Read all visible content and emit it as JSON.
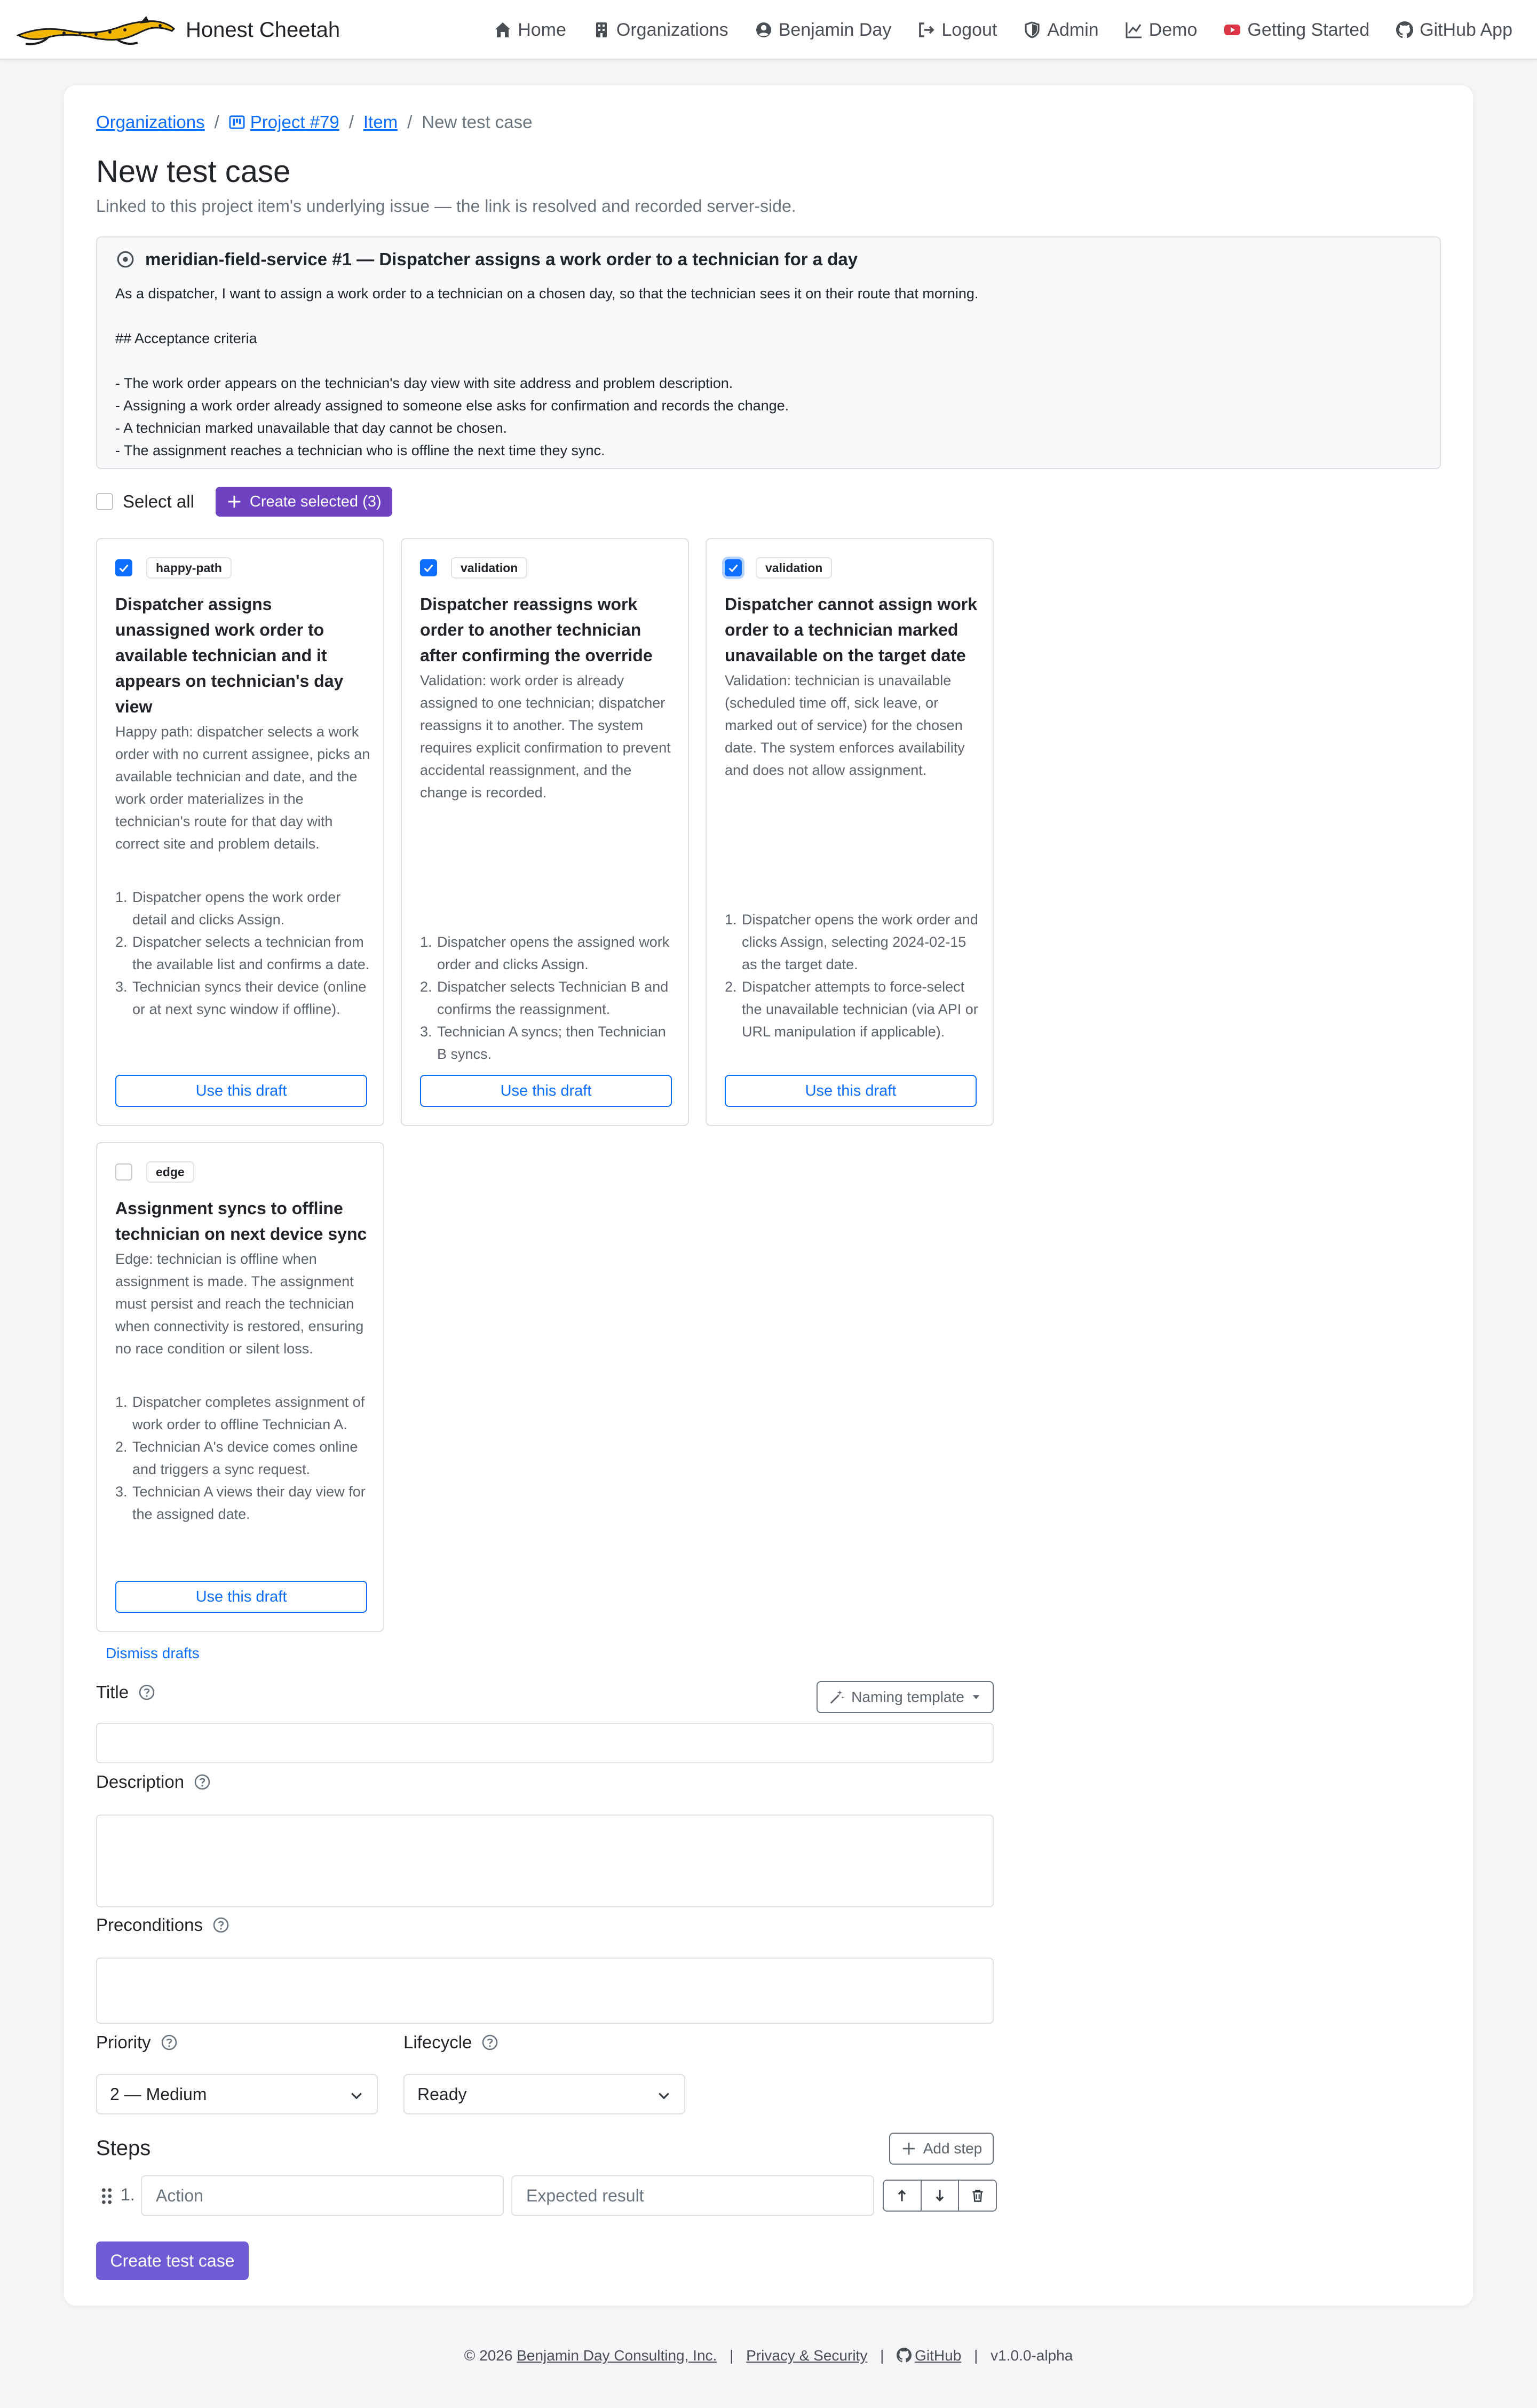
{
  "nav": {
    "brand": "Honest Cheetah",
    "links": [
      {
        "label": "Home",
        "icon": "house-icon"
      },
      {
        "label": "Organizations",
        "icon": "building-icon"
      },
      {
        "label": "Benjamin Day",
        "icon": "person-circle-icon"
      },
      {
        "label": "Logout",
        "icon": "logout-icon"
      },
      {
        "label": "Admin",
        "icon": "shield-icon"
      },
      {
        "label": "Demo",
        "icon": "graph-icon"
      },
      {
        "label": "Getting Started",
        "icon": "youtube-icon"
      },
      {
        "label": "GitHub App",
        "icon": "github-icon"
      }
    ]
  },
  "breadcrumb": {
    "organizations": "Organizations",
    "project": "Project #79",
    "item": "Item",
    "current": "New test case"
  },
  "page": {
    "title": "New test case",
    "subtitle": "Linked to this project item's underlying issue — the link is resolved and recorded server-side."
  },
  "issue": {
    "title": "meridian-field-service #1 — Dispatcher assigns a work order to a technician for a day",
    "body": "As a dispatcher, I want to assign a work order to a technician on a chosen day, so that the technician sees it on their route that morning.\n\n## Acceptance criteria\n\n- The work order appears on the technician's day view with site address and problem description.\n- Assigning a work order already assigned to someone else asks for confirmation and records the change.\n- A technician marked unavailable that day cannot be chosen.\n- The assignment reaches a technician who is offline the next time they sync."
  },
  "selection": {
    "select_all": "Select all",
    "create_selected": "Create selected (3)"
  },
  "drafts": [
    {
      "tag": "happy-path",
      "checked": true,
      "title": "Dispatcher assigns unassigned work order to available technician and it appears on technician's day view",
      "description": "Happy path: dispatcher selects a work order with no current assignee, picks an available technician and date, and the work order materializes in the technician's route for that day with correct site and problem details.",
      "steps": [
        "Dispatcher opens the work order detail and clicks Assign.",
        "Dispatcher selects a technician from the available list and confirms a date.",
        "Technician syncs their device (online or at next sync window if offline)."
      ],
      "button": "Use this draft"
    },
    {
      "tag": "validation",
      "checked": true,
      "title": "Dispatcher reassigns work order to another technician after confirming the override",
      "description": "Validation: work order is already assigned to one technician; dispatcher reassigns it to another. The system requires explicit confirmation to prevent accidental reassignment, and the change is recorded.",
      "steps": [
        "Dispatcher opens the assigned work order and clicks Assign.",
        "Dispatcher selects Technician B and confirms the reassignment.",
        "Technician A syncs; then Technician B syncs."
      ],
      "button": "Use this draft"
    },
    {
      "tag": "validation",
      "checked": true,
      "title": "Dispatcher cannot assign work order to a technician marked unavailable on the target date",
      "description": "Validation: technician is unavailable (scheduled time off, sick leave, or marked out of service) for the chosen date. The system enforces availability and does not allow assignment.",
      "steps": [
        "Dispatcher opens the work order and clicks Assign, selecting 2024-02-15 as the target date.",
        "Dispatcher attempts to force-select the unavailable technician (via API or URL manipulation if applicable)."
      ],
      "button": "Use this draft"
    },
    {
      "tag": "edge",
      "checked": false,
      "title": "Assignment syncs to offline technician on next device sync",
      "description": "Edge: technician is offline when assignment is made. The assignment must persist and reach the technician when connectivity is restored, ensuring no race condition or silent loss.",
      "steps": [
        "Dispatcher completes assignment of work order to offline Technician A.",
        "Technician A's device comes online and triggers a sync request.",
        "Technician A views their day view for the assigned date."
      ],
      "button": "Use this draft"
    }
  ],
  "dismiss_drafts": "Dismiss drafts",
  "form": {
    "title_label": "Title",
    "title_value": "",
    "naming_template": "Naming template",
    "description_label": "Description",
    "description_value": "",
    "preconditions_label": "Preconditions",
    "preconditions_value": "",
    "priority_label": "Priority",
    "priority_value": "2 — Medium",
    "lifecycle_label": "Lifecycle",
    "lifecycle_value": "Ready",
    "steps_title": "Steps",
    "add_step": "Add step",
    "step_number": "1.",
    "action_placeholder": "Action",
    "expected_placeholder": "Expected result",
    "submit": "Create test case"
  },
  "footer": {
    "copyright": "© 2026",
    "company": "Benjamin Day Consulting, Inc.",
    "privacy": "Privacy & Security",
    "github": "GitHub",
    "version": "v1.0.0-alpha"
  },
  "colors": {
    "primary": "#0d6efd",
    "purple": "#6f42c1",
    "submit": "#6f5bd3",
    "youtube": "#dc3545"
  }
}
